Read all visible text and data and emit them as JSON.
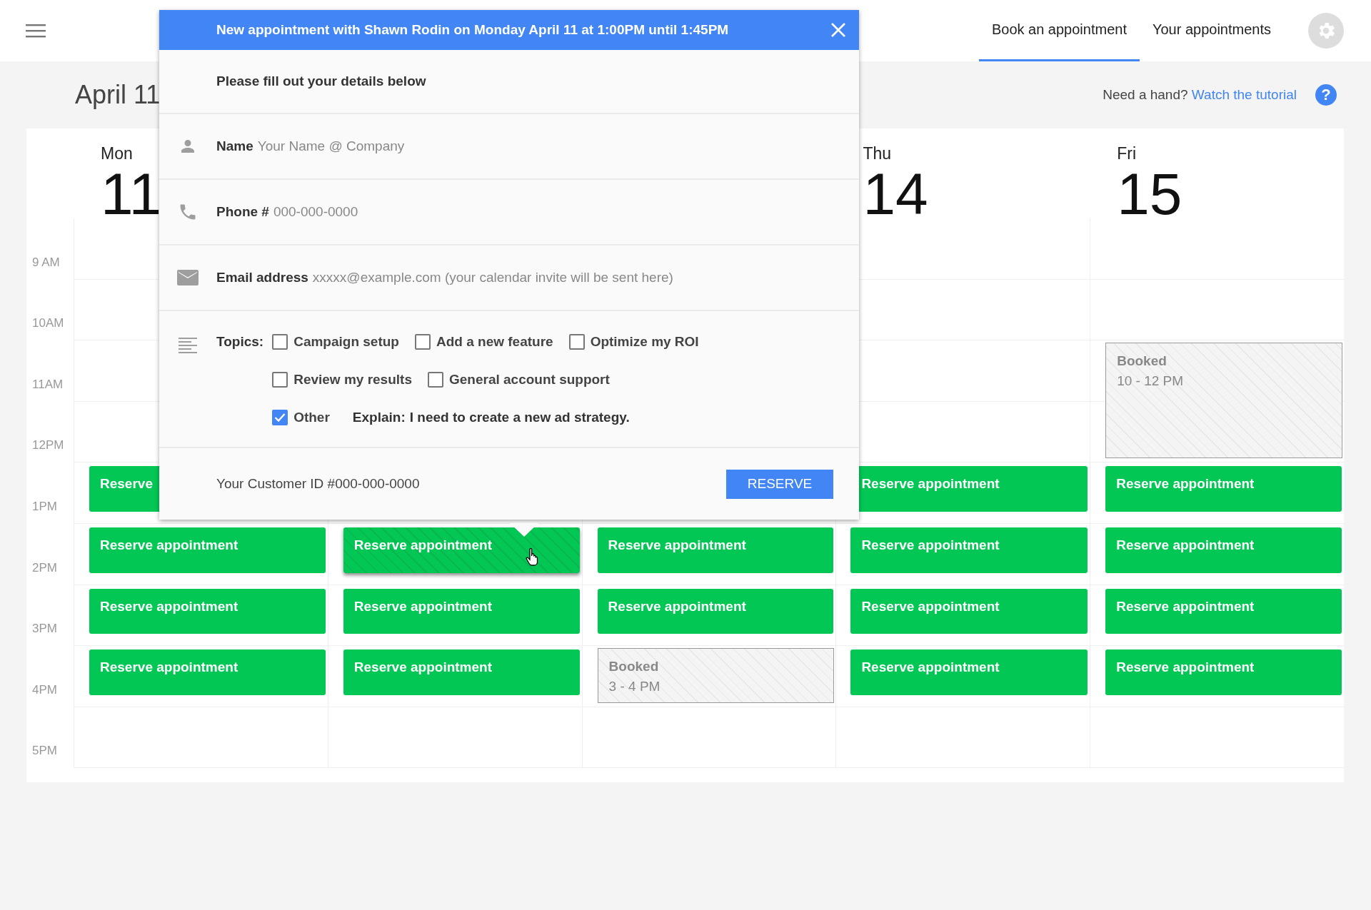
{
  "nav": {
    "tabs": [
      {
        "label": "Book an appointment",
        "selected": true
      },
      {
        "label": "Your appointments",
        "selected": false
      }
    ]
  },
  "date_heading": "April 11",
  "help": {
    "text": "Need a hand?",
    "link": "Watch the tutorial",
    "glyph": "?"
  },
  "calendar": {
    "times": [
      "9 AM",
      "10AM",
      "11AM",
      "12PM",
      "1PM",
      "2PM",
      "3PM",
      "4PM",
      "5PM"
    ],
    "days": [
      {
        "name": "Mon",
        "number": "11",
        "slots": [
          {
            "kind": "empty"
          },
          {
            "kind": "empty"
          },
          {
            "kind": "empty"
          },
          {
            "kind": "empty"
          },
          {
            "kind": "reserve",
            "label": "Reserve",
            "hovered": false
          },
          {
            "kind": "reserve",
            "label": "Reserve appointment",
            "hovered": false
          },
          {
            "kind": "reserve",
            "label": "Reserve appointment",
            "hovered": false
          },
          {
            "kind": "reserve",
            "label": "Reserve appointment",
            "hovered": false
          },
          {
            "kind": "empty"
          }
        ]
      },
      {
        "slots": [
          {
            "kind": "covered"
          },
          {
            "kind": "covered"
          },
          {
            "kind": "covered"
          },
          {
            "kind": "covered"
          },
          {
            "kind": "empty"
          },
          {
            "kind": "reserve",
            "label": "Reserve appointment",
            "hovered": true
          },
          {
            "kind": "reserve",
            "label": "Reserve appointment",
            "hovered": false
          },
          {
            "kind": "reserve",
            "label": "Reserve appointment",
            "hovered": false
          },
          {
            "kind": "empty"
          }
        ]
      },
      {
        "slots": [
          {
            "kind": "empty"
          },
          {
            "kind": "empty"
          },
          {
            "kind": "empty"
          },
          {
            "kind": "empty"
          },
          {
            "kind": "empty"
          },
          {
            "kind": "reserve",
            "label": "Reserve appointment",
            "hovered": false
          },
          {
            "kind": "reserve",
            "label": "Reserve appointment",
            "hovered": false
          },
          {
            "kind": "booked",
            "title": "Booked",
            "time": "3 - 4 PM"
          },
          {
            "kind": "empty"
          }
        ]
      },
      {
        "name": "Thu",
        "number": "14",
        "slots": [
          {
            "kind": "empty"
          },
          {
            "kind": "empty"
          },
          {
            "kind": "empty"
          },
          {
            "kind": "empty"
          },
          {
            "kind": "reserve",
            "label": "Reserve appointment",
            "hovered": false
          },
          {
            "kind": "reserve",
            "label": "Reserve appointment",
            "hovered": false
          },
          {
            "kind": "reserve",
            "label": "Reserve appointment",
            "hovered": false
          },
          {
            "kind": "reserve",
            "label": "Reserve appointment",
            "hovered": false
          },
          {
            "kind": "empty"
          }
        ]
      },
      {
        "name": "Fri",
        "number": "15",
        "slots": [
          {
            "kind": "empty"
          },
          {
            "kind": "empty"
          },
          {
            "kind": "booked",
            "title": "Booked",
            "time": "10 - 12 PM"
          },
          {
            "kind": "continued"
          },
          {
            "kind": "reserve",
            "label": "Reserve appointment",
            "hovered": false
          },
          {
            "kind": "reserve",
            "label": "Reserve appointment",
            "hovered": false
          },
          {
            "kind": "reserve",
            "label": "Reserve appointment",
            "hovered": false
          },
          {
            "kind": "reserve",
            "label": "Reserve appointment",
            "hovered": false
          },
          {
            "kind": "empty"
          }
        ]
      }
    ]
  },
  "dialog": {
    "title": "New appointment with Shawn Rodin on Monday April 11 at 1:00PM until 1:45PM",
    "subtitle": "Please fill out your details below",
    "fields": [
      {
        "kind": "name",
        "label": "Name",
        "placeholder": "Your Name @ Company"
      },
      {
        "kind": "phone",
        "label": "Phone #",
        "placeholder": "000-000-0000"
      },
      {
        "kind": "email",
        "label": "Email address",
        "placeholder": "xxxxx@example.com (your calendar invite will be sent here)"
      }
    ],
    "topics": {
      "label": "Topics:",
      "rows": [
        [
          {
            "kind": "checkbox",
            "label": "Campaign setup",
            "checked": false
          },
          {
            "kind": "checkbox",
            "label": "Add a new feature",
            "checked": false
          },
          {
            "kind": "checkbox",
            "label": "Optimize my ROI",
            "checked": false
          }
        ],
        [
          {
            "kind": "checkbox",
            "label": "Review my results",
            "checked": false
          },
          {
            "kind": "checkbox",
            "label": "General account support",
            "checked": false
          }
        ],
        [
          {
            "kind": "checkbox",
            "label": "Other",
            "checked": true
          },
          {
            "kind": "explain",
            "label": "Explain:",
            "value": "I need to create a new ad strategy."
          }
        ]
      ]
    },
    "customer_id": "Your Customer ID #000-000-0000",
    "reserve_button": "RESERVE"
  }
}
